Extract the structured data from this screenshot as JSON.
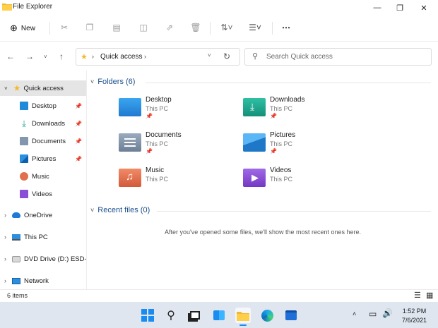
{
  "window": {
    "title": "File Explorer",
    "icons": [
      "folder-icon",
      "minimize-icon",
      "maximize-icon",
      "close-icon"
    ]
  },
  "command_bar": {
    "new_label": "New",
    "icons": [
      "cut-icon",
      "copy-icon",
      "paste-icon",
      "rename-icon",
      "share-icon",
      "delete-icon",
      "sort-icon",
      "view-icon",
      "more-icon"
    ]
  },
  "nav": {
    "address_location": "Quick access",
    "search_placeholder": "Search Quick access"
  },
  "sidebar": {
    "quick_access": "Quick access",
    "items": [
      {
        "label": "Desktop",
        "pinned": true
      },
      {
        "label": "Downloads",
        "pinned": true
      },
      {
        "label": "Documents",
        "pinned": true
      },
      {
        "label": "Pictures",
        "pinned": true
      },
      {
        "label": "Music",
        "pinned": false
      },
      {
        "label": "Videos",
        "pinned": false
      }
    ],
    "roots": [
      "OneDrive",
      "This PC",
      "DVD Drive (D:) ESD-I",
      "Network"
    ]
  },
  "main": {
    "folders_heading": "Folders (6)",
    "folders": [
      {
        "name": "Desktop",
        "location": "This PC",
        "pinned": true,
        "color": "#1f8ad8"
      },
      {
        "name": "Downloads",
        "location": "This PC",
        "pinned": true,
        "color": "#1aa38a"
      },
      {
        "name": "Documents",
        "location": "This PC",
        "pinned": true,
        "color": "#6d7f95"
      },
      {
        "name": "Pictures",
        "location": "This PC",
        "pinned": true,
        "color": "#2a8fe0"
      },
      {
        "name": "Music",
        "location": "This PC",
        "pinned": false,
        "color": "#e0704f"
      },
      {
        "name": "Videos",
        "location": "This PC",
        "pinned": false,
        "color": "#8a4fd6"
      }
    ],
    "recent_heading": "Recent files (0)",
    "recent_empty": "After you've opened some files, we'll show the most recent ones here."
  },
  "status": {
    "item_count": "6 items"
  },
  "taskbar": {
    "time": "1:52 PM",
    "date": "7/6/2021"
  },
  "colors": {
    "accent": "#1a4f8b",
    "selected_bg": "#e5e5e5",
    "taskbar_bg": "#dfe6f0"
  }
}
